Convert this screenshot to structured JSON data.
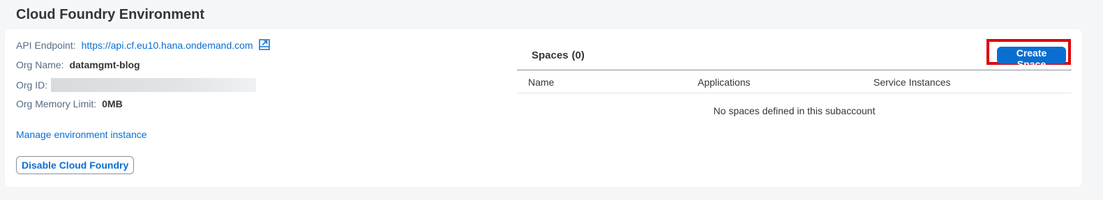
{
  "page": {
    "title": "Cloud Foundry Environment"
  },
  "info": {
    "api_endpoint_label": "API Endpoint:",
    "api_endpoint_value": "https://api.cf.eu10.hana.ondemand.com",
    "org_name_label": "Org Name:",
    "org_name_value": "datamgmt-blog",
    "org_id_label": "Org ID:",
    "org_memory_label": "Org Memory Limit:",
    "org_memory_value": "0MB",
    "icons": {
      "external_link": "external-link-icon"
    }
  },
  "actions": {
    "manage_link": "Manage environment instance",
    "disable_button": "Disable Cloud Foundry"
  },
  "spaces": {
    "title": "Spaces",
    "count": "(0)",
    "create_button": "Create Space",
    "columns": [
      "Name",
      "Applications",
      "Service Instances"
    ],
    "empty_message": "No spaces defined in this subaccount"
  },
  "colors": {
    "accent": "#0a6ed1",
    "highlight": "#e00000",
    "background": "#f5f6f7",
    "card": "#ffffff",
    "text": "#32363a",
    "label": "#556b82"
  }
}
